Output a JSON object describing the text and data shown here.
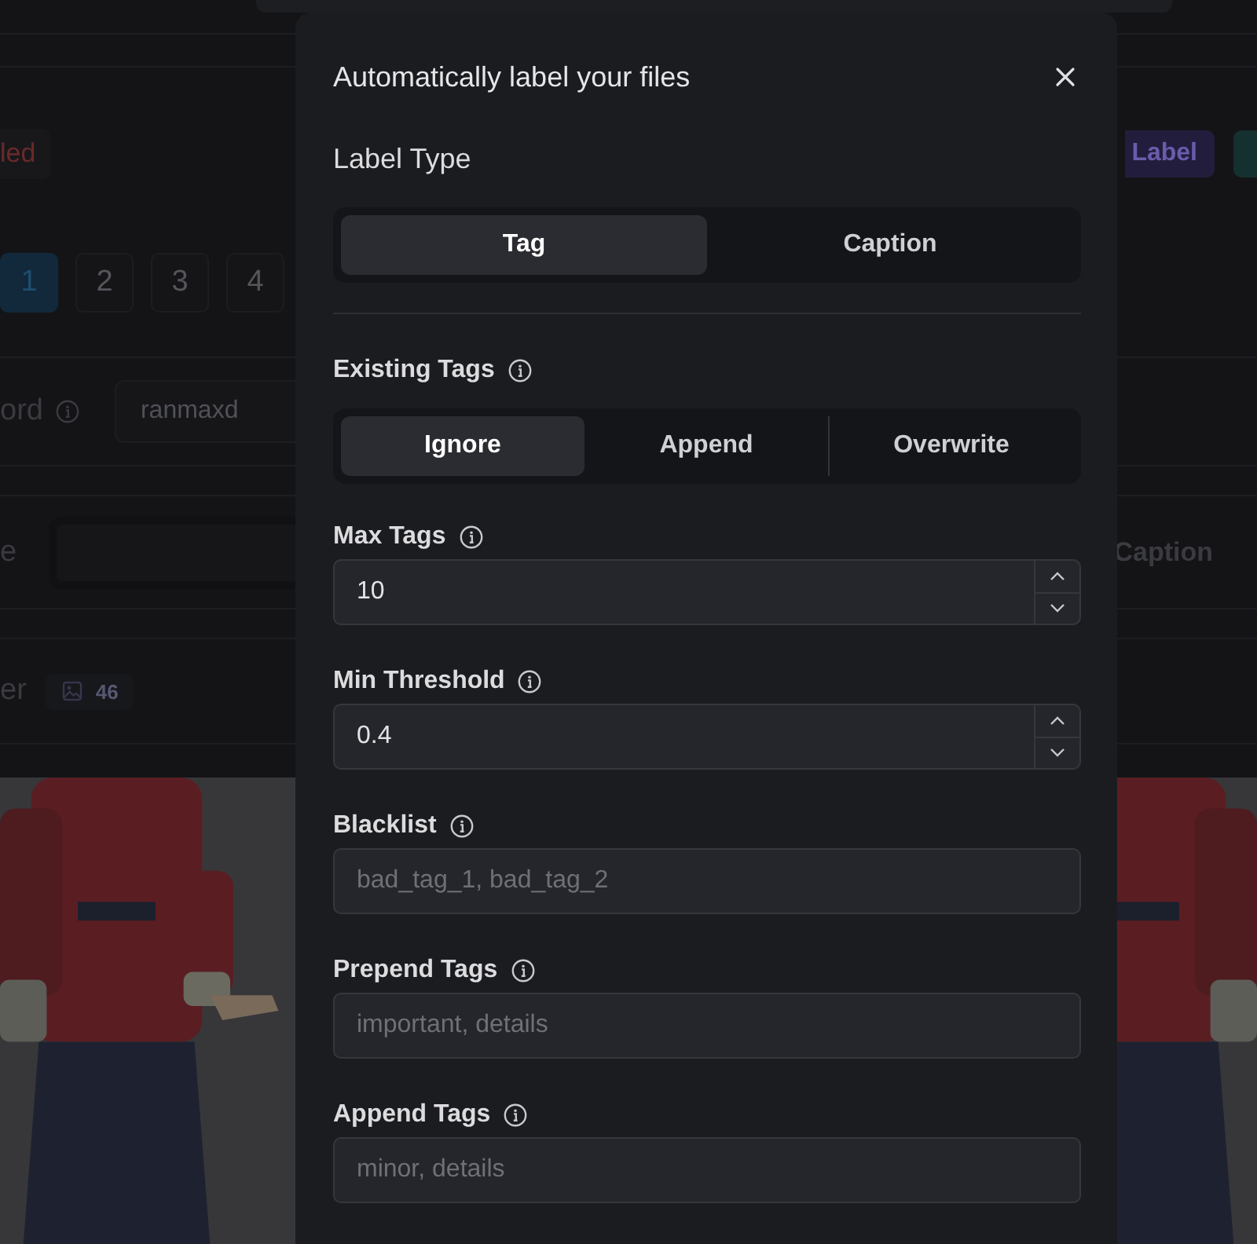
{
  "background": {
    "status_badge": "led",
    "auto_label_button": "Label",
    "pages": [
      {
        "label": "1",
        "selected": true
      },
      {
        "label": "2",
        "selected": false
      },
      {
        "label": "3",
        "selected": false
      },
      {
        "label": "4",
        "selected": false
      }
    ],
    "trigger_word": {
      "label": "ord",
      "info": true,
      "value": "ranmaxd"
    },
    "caption_row": {
      "label": "e",
      "caption_label": "Caption"
    },
    "image_count": {
      "label": "er",
      "count": "46"
    }
  },
  "dialog": {
    "title": "Automatically label your files",
    "label_type": {
      "label": "Label Type",
      "options": [
        {
          "label": "Tag",
          "selected": true
        },
        {
          "label": "Caption",
          "selected": false
        }
      ]
    },
    "existing_tags": {
      "label": "Existing Tags",
      "info": true,
      "options": [
        {
          "label": "Ignore",
          "selected": true
        },
        {
          "label": "Append",
          "selected": false
        },
        {
          "label": "Overwrite",
          "selected": false
        }
      ]
    },
    "fields": [
      {
        "kind": "number",
        "label": "Max Tags",
        "info": true,
        "value": "10"
      },
      {
        "kind": "number",
        "label": "Min Threshold",
        "info": true,
        "value": "0.4"
      },
      {
        "kind": "text",
        "label": "Blacklist",
        "info": true,
        "placeholder": "bad_tag_1, bad_tag_2"
      },
      {
        "kind": "text",
        "label": "Prepend Tags",
        "info": true,
        "placeholder": "important, details"
      },
      {
        "kind": "text",
        "label": "Append Tags",
        "info": true,
        "placeholder": "minor, details"
      }
    ]
  }
}
